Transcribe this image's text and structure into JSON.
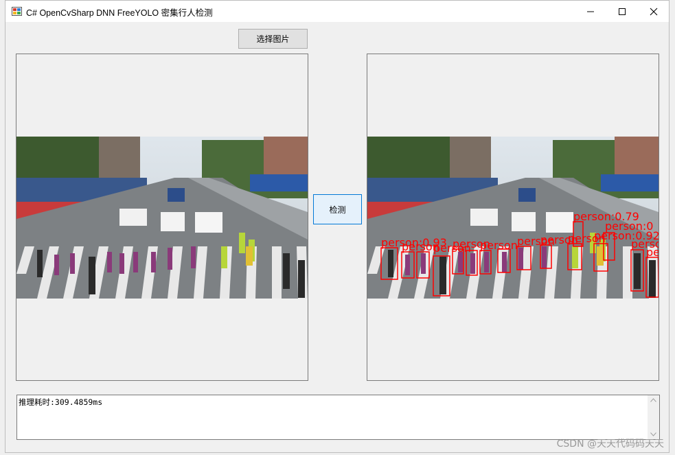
{
  "window": {
    "title": "C# OpenCvSharp DNN FreeYOLO 密集行人检测",
    "controls": [
      "minimize",
      "maximize",
      "close"
    ]
  },
  "buttons": {
    "select_image": "选择图片",
    "detect": "检测"
  },
  "left_picture": {
    "description_icon": "street-crosswalk-photo"
  },
  "right_picture": {
    "description_icon": "street-crosswalk-photo-with-detections",
    "box_color": "#ff0000",
    "labels": [
      "person:0.93",
      "person:0.79",
      "person:0",
      "person:0.920",
      "person",
      "pe"
    ]
  },
  "output": {
    "text": "推理耗时:309.4859ms"
  },
  "watermark": "CSDN @天天代码码天天",
  "colors": {
    "accent": "#0078d7",
    "detection": "#ff0000"
  }
}
